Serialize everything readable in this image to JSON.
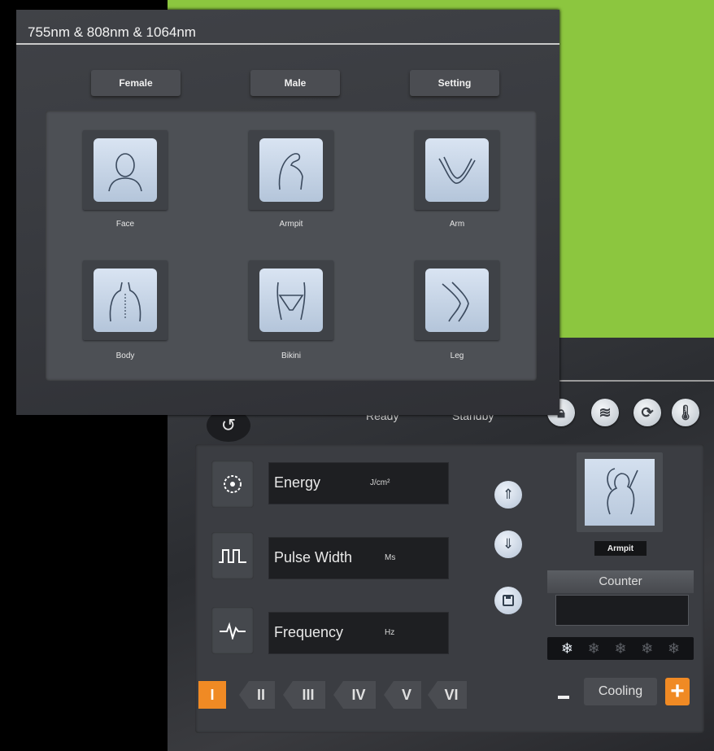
{
  "front": {
    "title": "755nm & 808nm & 1064nm",
    "tabs": [
      "Female",
      "Male",
      "Setting"
    ],
    "parts": [
      {
        "label": "Face",
        "icon": "face-icon"
      },
      {
        "label": "Armpit",
        "icon": "armpit-icon"
      },
      {
        "label": "Arm",
        "icon": "arm-icon"
      },
      {
        "label": "Body",
        "icon": "body-icon"
      },
      {
        "label": "Bikini",
        "icon": "bikini-icon"
      },
      {
        "label": "Leg",
        "icon": "leg-icon"
      }
    ]
  },
  "back": {
    "status": [
      "Ready",
      "Standby"
    ],
    "status_icons": [
      "lock-icon",
      "water-icon",
      "cycle-icon",
      "thermometer-icon"
    ],
    "params": [
      {
        "label": "Energy",
        "unit": "J/cm²",
        "icon": "energy-dial-icon"
      },
      {
        "label": "Pulse Width",
        "unit": "Ms",
        "icon": "pulse-wave-icon"
      },
      {
        "label": "Frequency",
        "unit": "Hz",
        "icon": "heartbeat-icon"
      }
    ],
    "side_buttons": [
      "arrow-up-icon",
      "arrow-down-icon",
      "save-icon"
    ],
    "levels": [
      "I",
      "II",
      "III",
      "IV",
      "V",
      "VI"
    ],
    "active_level": "I",
    "selected_part": "Armpit",
    "counter_label": "Counter",
    "counter_value": "",
    "cooling_label": "Cooling",
    "cooling_level": 1,
    "cooling_max": 5
  },
  "colors": {
    "accent": "#f08a24",
    "background": "#8cc63f"
  }
}
